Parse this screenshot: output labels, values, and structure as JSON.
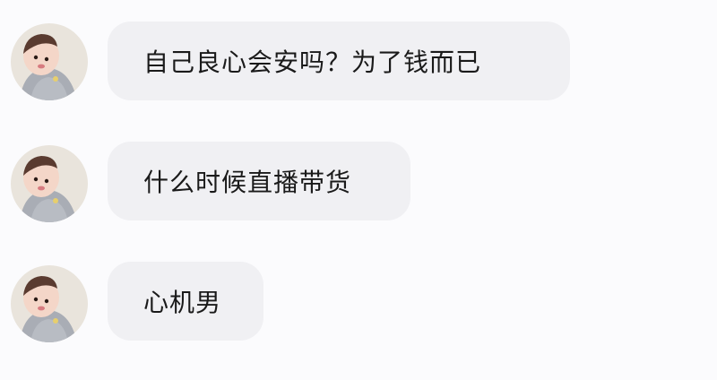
{
  "chat": {
    "messages": [
      {
        "avatar": "baby-avatar",
        "text": "自己良心会安吗？为了钱而已"
      },
      {
        "avatar": "baby-avatar",
        "text": "什么时候直播带货"
      },
      {
        "avatar": "baby-avatar",
        "text": "心机男"
      }
    ]
  },
  "colors": {
    "background": "#fbfbfd",
    "bubble": "#f0f0f3",
    "text": "#1a1a1a"
  }
}
